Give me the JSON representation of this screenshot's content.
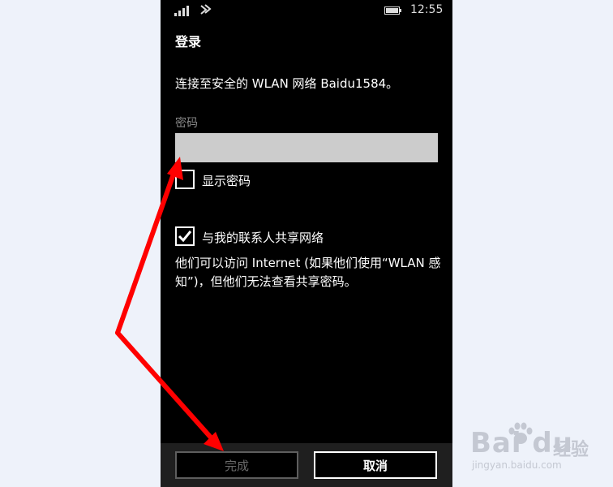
{
  "status_bar": {
    "icons": [
      "signal-strength-icon",
      "wifi-icon",
      "battery-icon"
    ],
    "time": "12:55"
  },
  "page": {
    "title": "登录",
    "description": "连接至安全的 WLAN 网络 Baidu1584。"
  },
  "password": {
    "label": "密码",
    "value": "",
    "placeholder": ""
  },
  "show_password": {
    "label": "显示密码",
    "checked": false
  },
  "share_network": {
    "label": "与我的联系人共享网络",
    "checked": true,
    "note": "他们可以访问 Internet (如果他们使用“WLAN 感知”)，但他们无法查看共享密码。"
  },
  "app_bar": {
    "done_label": "完成",
    "cancel_label": "取消"
  },
  "watermark": {
    "brand": "Bai du",
    "suffix": "经验",
    "url": "jingyan.baidu.com"
  },
  "colors": {
    "background": "#eef2fa",
    "phone_background": "#000000",
    "input_fill": "#cccccc",
    "app_bar": "#1f1f1f",
    "arrow": "#ff0000",
    "disabled_text": "#6a6a6a"
  }
}
